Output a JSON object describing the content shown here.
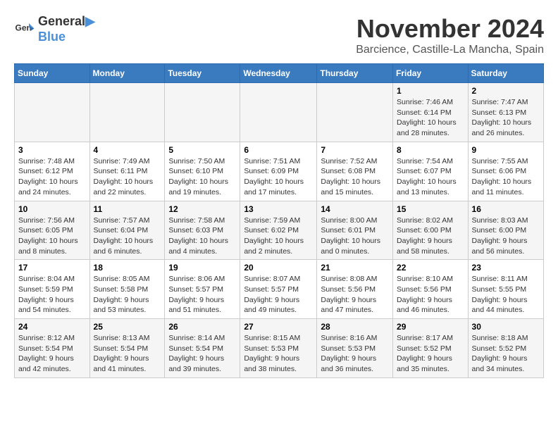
{
  "header": {
    "logo_line1": "General",
    "logo_line2": "Blue",
    "month": "November 2024",
    "location": "Barcience, Castille-La Mancha, Spain"
  },
  "weekdays": [
    "Sunday",
    "Monday",
    "Tuesday",
    "Wednesday",
    "Thursday",
    "Friday",
    "Saturday"
  ],
  "weeks": [
    [
      {
        "day": "",
        "info": ""
      },
      {
        "day": "",
        "info": ""
      },
      {
        "day": "",
        "info": ""
      },
      {
        "day": "",
        "info": ""
      },
      {
        "day": "",
        "info": ""
      },
      {
        "day": "1",
        "info": "Sunrise: 7:46 AM\nSunset: 6:14 PM\nDaylight: 10 hours and 28 minutes."
      },
      {
        "day": "2",
        "info": "Sunrise: 7:47 AM\nSunset: 6:13 PM\nDaylight: 10 hours and 26 minutes."
      }
    ],
    [
      {
        "day": "3",
        "info": "Sunrise: 7:48 AM\nSunset: 6:12 PM\nDaylight: 10 hours and 24 minutes."
      },
      {
        "day": "4",
        "info": "Sunrise: 7:49 AM\nSunset: 6:11 PM\nDaylight: 10 hours and 22 minutes."
      },
      {
        "day": "5",
        "info": "Sunrise: 7:50 AM\nSunset: 6:10 PM\nDaylight: 10 hours and 19 minutes."
      },
      {
        "day": "6",
        "info": "Sunrise: 7:51 AM\nSunset: 6:09 PM\nDaylight: 10 hours and 17 minutes."
      },
      {
        "day": "7",
        "info": "Sunrise: 7:52 AM\nSunset: 6:08 PM\nDaylight: 10 hours and 15 minutes."
      },
      {
        "day": "8",
        "info": "Sunrise: 7:54 AM\nSunset: 6:07 PM\nDaylight: 10 hours and 13 minutes."
      },
      {
        "day": "9",
        "info": "Sunrise: 7:55 AM\nSunset: 6:06 PM\nDaylight: 10 hours and 11 minutes."
      }
    ],
    [
      {
        "day": "10",
        "info": "Sunrise: 7:56 AM\nSunset: 6:05 PM\nDaylight: 10 hours and 8 minutes."
      },
      {
        "day": "11",
        "info": "Sunrise: 7:57 AM\nSunset: 6:04 PM\nDaylight: 10 hours and 6 minutes."
      },
      {
        "day": "12",
        "info": "Sunrise: 7:58 AM\nSunset: 6:03 PM\nDaylight: 10 hours and 4 minutes."
      },
      {
        "day": "13",
        "info": "Sunrise: 7:59 AM\nSunset: 6:02 PM\nDaylight: 10 hours and 2 minutes."
      },
      {
        "day": "14",
        "info": "Sunrise: 8:00 AM\nSunset: 6:01 PM\nDaylight: 10 hours and 0 minutes."
      },
      {
        "day": "15",
        "info": "Sunrise: 8:02 AM\nSunset: 6:00 PM\nDaylight: 9 hours and 58 minutes."
      },
      {
        "day": "16",
        "info": "Sunrise: 8:03 AM\nSunset: 6:00 PM\nDaylight: 9 hours and 56 minutes."
      }
    ],
    [
      {
        "day": "17",
        "info": "Sunrise: 8:04 AM\nSunset: 5:59 PM\nDaylight: 9 hours and 54 minutes."
      },
      {
        "day": "18",
        "info": "Sunrise: 8:05 AM\nSunset: 5:58 PM\nDaylight: 9 hours and 53 minutes."
      },
      {
        "day": "19",
        "info": "Sunrise: 8:06 AM\nSunset: 5:57 PM\nDaylight: 9 hours and 51 minutes."
      },
      {
        "day": "20",
        "info": "Sunrise: 8:07 AM\nSunset: 5:57 PM\nDaylight: 9 hours and 49 minutes."
      },
      {
        "day": "21",
        "info": "Sunrise: 8:08 AM\nSunset: 5:56 PM\nDaylight: 9 hours and 47 minutes."
      },
      {
        "day": "22",
        "info": "Sunrise: 8:10 AM\nSunset: 5:56 PM\nDaylight: 9 hours and 46 minutes."
      },
      {
        "day": "23",
        "info": "Sunrise: 8:11 AM\nSunset: 5:55 PM\nDaylight: 9 hours and 44 minutes."
      }
    ],
    [
      {
        "day": "24",
        "info": "Sunrise: 8:12 AM\nSunset: 5:54 PM\nDaylight: 9 hours and 42 minutes."
      },
      {
        "day": "25",
        "info": "Sunrise: 8:13 AM\nSunset: 5:54 PM\nDaylight: 9 hours and 41 minutes."
      },
      {
        "day": "26",
        "info": "Sunrise: 8:14 AM\nSunset: 5:54 PM\nDaylight: 9 hours and 39 minutes."
      },
      {
        "day": "27",
        "info": "Sunrise: 8:15 AM\nSunset: 5:53 PM\nDaylight: 9 hours and 38 minutes."
      },
      {
        "day": "28",
        "info": "Sunrise: 8:16 AM\nSunset: 5:53 PM\nDaylight: 9 hours and 36 minutes."
      },
      {
        "day": "29",
        "info": "Sunrise: 8:17 AM\nSunset: 5:52 PM\nDaylight: 9 hours and 35 minutes."
      },
      {
        "day": "30",
        "info": "Sunrise: 8:18 AM\nSunset: 5:52 PM\nDaylight: 9 hours and 34 minutes."
      }
    ]
  ]
}
